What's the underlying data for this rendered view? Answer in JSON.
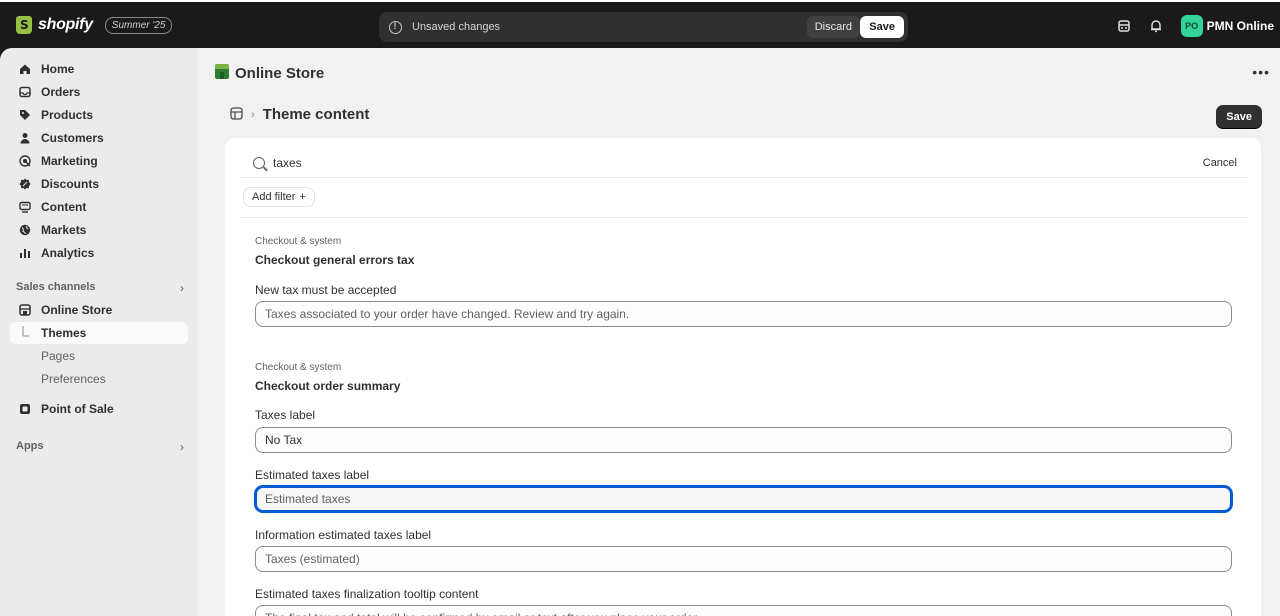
{
  "topbar": {
    "brand": "shopify",
    "edition_badge": "Summer '25",
    "unsaved_message": "Unsaved changes",
    "discard_label": "Discard",
    "save_label": "Save",
    "avatar_initials": "PO",
    "store_name": "PMN Online",
    "icons": [
      "store-icon",
      "bell-icon"
    ]
  },
  "sidebar": {
    "items": [
      {
        "label": "Home",
        "icon": "home-icon"
      },
      {
        "label": "Orders",
        "icon": "inbox-icon"
      },
      {
        "label": "Products",
        "icon": "tag-icon"
      },
      {
        "label": "Customers",
        "icon": "person-icon"
      },
      {
        "label": "Marketing",
        "icon": "target-icon"
      },
      {
        "label": "Discounts",
        "icon": "discount-icon"
      },
      {
        "label": "Content",
        "icon": "content-icon"
      },
      {
        "label": "Markets",
        "icon": "globe-icon"
      },
      {
        "label": "Analytics",
        "icon": "chart-icon"
      }
    ],
    "sales_channels_label": "Sales channels",
    "channels": [
      {
        "label": "Online Store",
        "icon": "storefront-icon"
      },
      {
        "label": "Themes"
      },
      {
        "label": "Pages"
      },
      {
        "label": "Preferences"
      },
      {
        "label": "Point of Sale",
        "icon": "pos-icon"
      }
    ],
    "apps_label": "Apps"
  },
  "main": {
    "page_title": "Online Store",
    "more_label": "•••",
    "breadcrumb_title": "Theme content",
    "save_label": "Save",
    "search": {
      "value": "taxes",
      "cancel_label": "Cancel"
    },
    "add_filter_label": "Add filter",
    "groups": [
      {
        "category": "Checkout & system",
        "title": "Checkout general errors tax",
        "fields": [
          {
            "label": "New tax must be accepted",
            "value": "Taxes associated to your order have changed. Review and try again."
          }
        ]
      },
      {
        "category": "Checkout & system",
        "title": "Checkout order summary",
        "fields": [
          {
            "label": "Taxes label",
            "value": "No Tax"
          },
          {
            "label": "Estimated taxes label",
            "value": "Estimated taxes"
          },
          {
            "label": "Information estimated taxes label",
            "value": "Taxes (estimated)"
          },
          {
            "label": "Estimated taxes finalization tooltip content",
            "value": "The final tax and total will be confirmed by email or text after you place your order."
          }
        ]
      }
    ]
  },
  "colors": {
    "accent_focus": "#005bd3",
    "avatar": "#34d399",
    "topbar": "#1a1a1a"
  }
}
